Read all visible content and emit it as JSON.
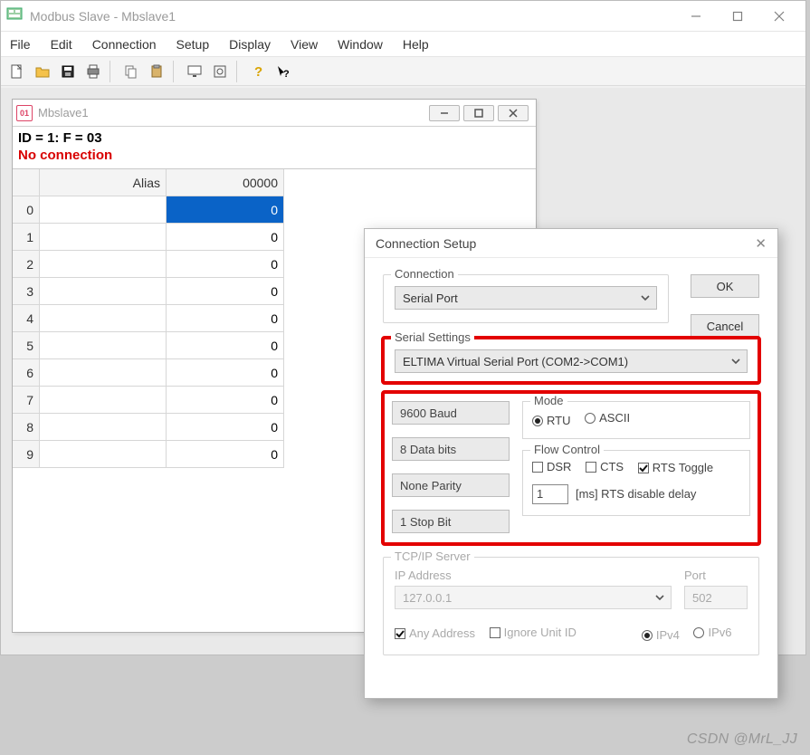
{
  "app": {
    "title": "Modbus Slave - Mbslave1"
  },
  "menu": {
    "file": "File",
    "edit": "Edit",
    "connection": "Connection",
    "setup": "Setup",
    "display": "Display",
    "view": "View",
    "window": "Window",
    "help": "Help"
  },
  "child": {
    "title": "Mbslave1",
    "status": "ID = 1: F = 03",
    "conn": "No connection",
    "headers": {
      "alias": "Alias",
      "reg": "00000"
    },
    "rows": [
      {
        "idx": "0",
        "alias": "",
        "val": "0",
        "selected": true
      },
      {
        "idx": "1",
        "alias": "",
        "val": "0"
      },
      {
        "idx": "2",
        "alias": "",
        "val": "0"
      },
      {
        "idx": "3",
        "alias": "",
        "val": "0"
      },
      {
        "idx": "4",
        "alias": "",
        "val": "0"
      },
      {
        "idx": "5",
        "alias": "",
        "val": "0"
      },
      {
        "idx": "6",
        "alias": "",
        "val": "0"
      },
      {
        "idx": "7",
        "alias": "",
        "val": "0"
      },
      {
        "idx": "8",
        "alias": "",
        "val": "0"
      },
      {
        "idx": "9",
        "alias": "",
        "val": "0"
      }
    ]
  },
  "dialog": {
    "title": "Connection Setup",
    "ok": "OK",
    "cancel": "Cancel",
    "connection": {
      "label": "Connection",
      "value": "Serial Port"
    },
    "serial": {
      "label": "Serial Settings",
      "port": "ELTIMA Virtual Serial Port (COM2->COM1)",
      "baud": "9600 Baud",
      "databits": "8 Data bits",
      "parity": "None Parity",
      "stopbit": "1 Stop Bit"
    },
    "mode": {
      "label": "Mode",
      "rtu": "RTU",
      "ascii": "ASCII"
    },
    "flow": {
      "label": "Flow Control",
      "dsr": "DSR",
      "cts": "CTS",
      "rts": "RTS Toggle",
      "delay_val": "1",
      "delay_lbl": "[ms] RTS disable delay"
    },
    "tcp": {
      "label": "TCP/IP Server",
      "ip_lbl": "IP Address",
      "ip": "127.0.0.1",
      "port_lbl": "Port",
      "port": "502",
      "any": "Any Address",
      "ignore": "Ignore Unit ID",
      "ipv4": "IPv4",
      "ipv6": "IPv6"
    }
  },
  "watermark": "CSDN @MrL_JJ"
}
